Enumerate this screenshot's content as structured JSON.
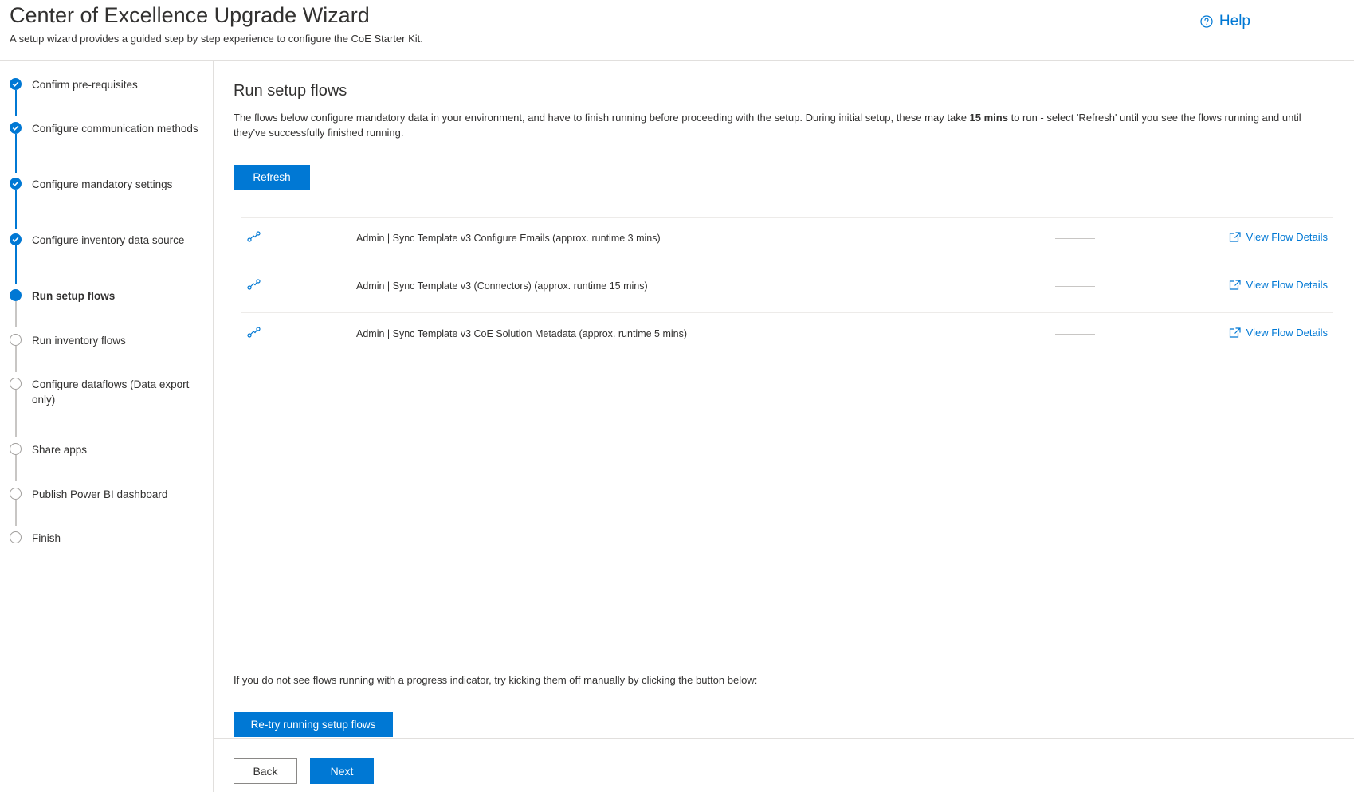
{
  "header": {
    "title": "Center of Excellence Upgrade Wizard",
    "subtitle": "A setup wizard provides a guided step by step experience to configure the CoE Starter Kit.",
    "help_label": "Help",
    "help_icon": "question-circle-icon"
  },
  "sidebar": {
    "steps": [
      {
        "label": "Confirm pre-requisites",
        "status": "done"
      },
      {
        "label": "Configure communication methods",
        "status": "done"
      },
      {
        "label": "Configure mandatory settings",
        "status": "done"
      },
      {
        "label": "Configure inventory data source",
        "status": "done"
      },
      {
        "label": "Run setup flows",
        "status": "current"
      },
      {
        "label": "Run inventory flows",
        "status": "todo"
      },
      {
        "label": "Configure dataflows (Data export only)",
        "status": "todo"
      },
      {
        "label": "Share apps",
        "status": "todo"
      },
      {
        "label": "Publish Power BI dashboard",
        "status": "todo"
      },
      {
        "label": "Finish",
        "status": "todo"
      }
    ]
  },
  "main": {
    "title": "Run setup flows",
    "description_before": "The flows below configure mandatory data in your environment, and have to finish running before proceeding with the setup. During initial setup, these may take ",
    "description_bold": "15 mins",
    "description_after": " to run - select 'Refresh' until you see the flows running and until they've successfully finished running.",
    "refresh_label": "Refresh",
    "flows": [
      {
        "name": "Admin | Sync Template v3 Configure Emails (approx. runtime 3 mins)",
        "link_label": "View Flow Details",
        "icon": "flow-icon"
      },
      {
        "name": "Admin | Sync Template v3 (Connectors) (approx. runtime 15 mins)",
        "link_label": "View Flow Details",
        "icon": "flow-icon"
      },
      {
        "name": "Admin | Sync Template v3 CoE Solution Metadata (approx. runtime 5 mins)",
        "link_label": "View Flow Details",
        "icon": "flow-icon"
      }
    ],
    "hint": "If you do not see flows running with a progress indicator, try kicking them off manually by clicking the button below:",
    "retry_label": "Re-try running setup flows"
  },
  "footer": {
    "back_label": "Back",
    "next_label": "Next"
  },
  "colors": {
    "accent": "#0078d4",
    "text": "#323130",
    "border": "#e1dfdd",
    "inactive": "#a19f9d"
  }
}
